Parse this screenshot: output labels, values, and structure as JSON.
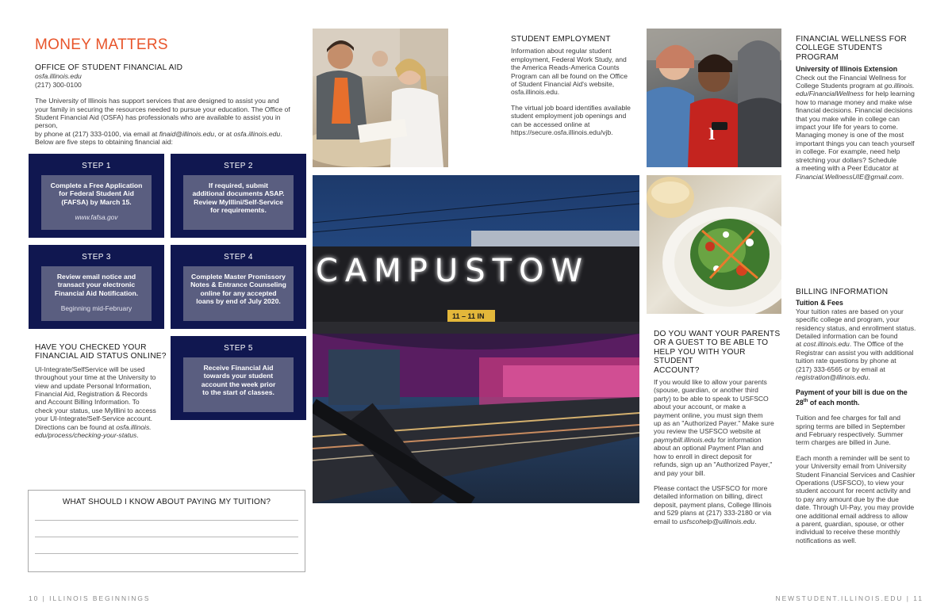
{
  "left_page": {
    "heading": "MONEY MATTERS",
    "osfa": {
      "title": "OFFICE OF STUDENT FINANCIAL AID",
      "website": "osfa.illinois.edu",
      "phone": "(217) 300-0100",
      "intro_lines": [
        "The University of Illinois has support services that are designed to assist you and",
        "your family in securing the resources needed to pursue your education. The Office of",
        "Student Financial Aid (OSFA) has professionals who are available to assist you in person,"
      ],
      "contact_line_parts": [
        "by phone at (217) 333-0100, via email at ",
        "finaid@illinois.edu",
        ", or at ",
        "osfa.illinois.edu",
        "."
      ],
      "steps_intro": "Below are five steps to obtaining financial aid:"
    },
    "steps": [
      {
        "label": "STEP 1",
        "lines": [
          "Complete a Free Application",
          "for Federal Student Aid",
          "(FAFSA) by March 15."
        ],
        "sub": "www.fafsa.gov"
      },
      {
        "label": "STEP 2",
        "lines": [
          "If required, submit",
          "additional documents ASAP.",
          "Review MyIllini/Self-Service",
          "for requirements."
        ],
        "sub": ""
      },
      {
        "label": "STEP 3",
        "lines": [
          "Review email notice and",
          "transact your electronic",
          "Financial Aid Notification."
        ],
        "sub": "Beginning mid-February"
      },
      {
        "label": "STEP 4",
        "lines": [
          "Complete Master Promissory",
          "Notes & Entrance Counseling",
          "online for any accepted",
          "loans by end of July 2020."
        ],
        "sub": ""
      },
      {
        "label": "STEP 5",
        "lines": [
          "Receive Financial Aid",
          "towards your student",
          "account the week prior",
          "to the start of classes."
        ],
        "sub": ""
      }
    ],
    "status": {
      "title_lines": [
        "HAVE YOU CHECKED YOUR",
        "FINANCIAL AID STATUS ONLINE?"
      ],
      "body_lines": [
        "UI-Integrate/SelfService will be used",
        "throughout your time at the University to",
        "view and update Personal Information,",
        "Financial Aid, Registration & Records",
        "and Account Billing Information. To",
        "check your status, use MyIllini to access",
        "your UI-Integrate/Self-Service account."
      ],
      "dir_prefix": "Directions can be found at ",
      "dir_link_1": "osfa.illinois.",
      "dir_link_2": "edu/process/checking-your-status",
      "dir_suffix": "."
    },
    "tuition_box": {
      "title": "WHAT SHOULD I KNOW ABOUT PAYING MY TUITION?"
    },
    "footer": "10 | ILLINOIS BEGINNINGS"
  },
  "photo_sign": {
    "sign_text": "CAMPUSTOW",
    "hours_text": "11 – 11 IN"
  },
  "student_employment": {
    "title": "STUDENT EMPLOYMENT",
    "para1_lines": [
      "Information about regular student",
      "employment, Federal Work Study, and",
      "the America Reads-America Counts",
      "Program can all be found on the Office",
      "of Student Financial Aid's website,",
      "osfa.illinois.edu."
    ],
    "para2_lines": [
      "The virtual job board identifies available",
      "student employment job openings and",
      "can be accessed online at",
      "https://secure.osfa.illinois.edu/vjb."
    ]
  },
  "financial_wellness": {
    "title_lines": [
      "FINANCIAL WELLNESS FOR",
      "COLLEGE STUDENTS PROGRAM"
    ],
    "subtitle": "University of Illinois Extension",
    "line1": "Check out the Financial Wellness for",
    "line2_prefix": "College Students program at ",
    "line2_link": "go.illinois.",
    "line3_link": "edu/FinancialWellness",
    "line3_suffix": " for help learning",
    "body_lines": [
      "how to manage money and make wise",
      "financial decisions. Financial decisions",
      "that you make while in college can",
      "impact your life for years to come.",
      "Managing money is one of the most",
      "important things you can teach yourself",
      "in college. For example, need help",
      "stretching your dollars? Schedule",
      "a meeting with a Peer Educator at"
    ],
    "email": "Financial.WellnessUIE@gmail.com",
    "email_suffix": "."
  },
  "parents_guest": {
    "title_lines": [
      "DO YOU WANT YOUR PARENTS",
      "OR A GUEST TO BE ABLE TO",
      "HELP YOU WITH YOUR STUDENT",
      "ACCOUNT?"
    ],
    "para1_lines_a": [
      "If you would like to allow your parents",
      "(spouse, guardian, or another third",
      "party) to be able to speak to USFSCO",
      "about your account, or make a",
      "payment online, you must sign them",
      "up as an \"Authorized Payer.\" Make sure",
      "you review the USFSCO website at"
    ],
    "para1_link": "paymybill.illinois.edu",
    "para1_link_suffix": " for information",
    "para1_lines_b": [
      "about an optional Payment Plan and",
      "how to enroll in direct deposit for",
      "refunds, sign up an \"Authorized Payer,\"",
      "and pay your bill."
    ],
    "para2_lines": [
      "Please contact the USFSCO for more",
      "detailed information on billing, direct",
      "deposit, payment plans, College Illinois",
      "and 529 plans at (217) 333-2180 or via"
    ],
    "para2_last_prefix": "email to ",
    "para2_email": "usfscohelp@uillinois.edu",
    "para2_last_suffix": "."
  },
  "billing": {
    "title": "BILLING INFORMATION",
    "subtitle": "Tuition & Fees",
    "para1_lines": [
      "Your tuition rates are based on your",
      "specific college and program, your",
      "residency status, and enrollment status.",
      "Detailed information can be found"
    ],
    "para1_line5_prefix": "at ",
    "para1_line5_link": "cost.illinois.edu",
    "para1_line5_suffix": ". The Office of the",
    "para1_lines_b": [
      "Registrar can assist you with additional",
      "tuition rate questions by phone at",
      "(217) 333-6565 or by email at"
    ],
    "para1_email": "registration@illinois.edu",
    "para1_email_suffix": ".",
    "due_line1": "Payment of your bill is due on the",
    "due_num": "28",
    "due_sup": "th",
    "due_rest": " of each month.",
    "para2_lines": [
      "Tuition and fee charges for fall and",
      "spring terms are billed in September",
      "and February respectively. Summer",
      "term charges are billed in June."
    ],
    "para3_lines": [
      "Each month a reminder will be sent to",
      "your University email from University",
      "Student Financial Services and Cashier",
      "Operations (USFSCO), to view your",
      "student account for recent activity and",
      "to pay any amount due by the due",
      "date. Through UI-Pay, you may provide",
      "one additional email address to allow",
      "a parent, guardian, spouse, or other",
      "individual to receive these monthly",
      "notifications as well."
    ],
    "footer": "NEWSTUDENT.ILLINOIS.EDU | 11"
  },
  "colors": {
    "accent": "#e8542a",
    "step_bg": "#101750",
    "step_inner": "#5a5e80"
  }
}
